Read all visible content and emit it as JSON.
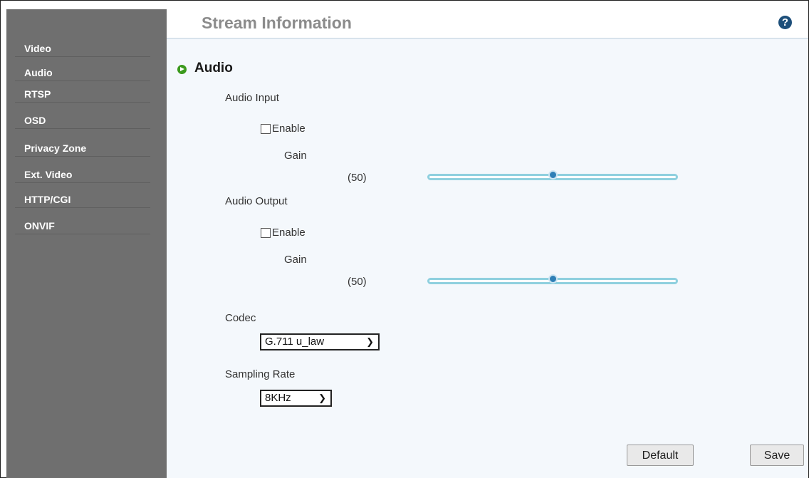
{
  "sidebar": {
    "items": [
      {
        "label": "Video"
      },
      {
        "label": "Audio"
      },
      {
        "label": "RTSP"
      },
      {
        "label": "OSD"
      },
      {
        "label": "Privacy Zone"
      },
      {
        "label": "Ext. Video"
      },
      {
        "label": "HTTP/CGI"
      },
      {
        "label": "ONVIF"
      }
    ]
  },
  "header": {
    "title": "Stream Information",
    "help_icon": "?"
  },
  "section": {
    "title": "Audio"
  },
  "audio_input": {
    "label": "Audio Input",
    "enable_label": "Enable",
    "enabled": false,
    "gain_label": "Gain",
    "gain_value_text": "(50)",
    "gain_level_percent": 50
  },
  "audio_output": {
    "label": "Audio Output",
    "enable_label": "Enable",
    "enabled": false,
    "gain_label": "Gain",
    "gain_value_text": "(50)",
    "gain_level_percent": 50
  },
  "codec": {
    "label": "Codec",
    "selected": "G.711 u_law"
  },
  "sampling_rate": {
    "label": "Sampling Rate",
    "selected": "8KHz"
  },
  "buttons": {
    "default_label": "Default",
    "save_label": "Save"
  },
  "colors": {
    "sidebar_bg": "#6f6f6f",
    "panel_bg": "#f4f8fc",
    "slider_track": "#8fd0df",
    "slider_thumb": "#2e7fb6",
    "section_icon": "#3c9a1e"
  }
}
